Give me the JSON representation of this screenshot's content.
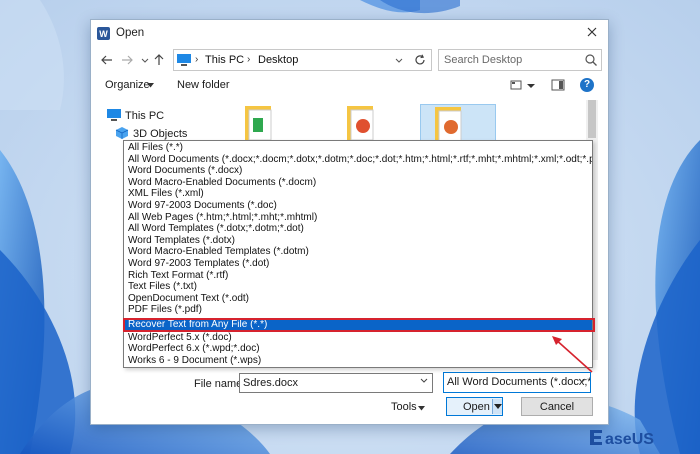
{
  "window": {
    "title": "Open",
    "app_icon": "word-icon"
  },
  "nav": {
    "back_icon": "back-arrow-icon",
    "forward_icon": "forward-arrow-icon",
    "recent_icon": "chevron-down-icon",
    "up_icon": "up-arrow-icon",
    "breadcrumb": [
      "This PC",
      "Desktop"
    ],
    "refresh_icon": "refresh-icon",
    "search_placeholder": "Search Desktop"
  },
  "toolbar": {
    "organize_label": "Organize",
    "new_folder_label": "New folder",
    "help_label": "?"
  },
  "navpane": {
    "items": [
      {
        "label": "This PC",
        "icon": "computer-icon"
      },
      {
        "label": "3D Objects",
        "icon": "cube-icon"
      }
    ]
  },
  "file_types": {
    "options": [
      "All Files (*.*)",
      "All Word Documents (*.docx;*.docm;*.dotx;*.dotm;*.doc;*.dot;*.htm;*.html;*.rtf;*.mht;*.mhtml;*.xml;*.odt;*.pdf)",
      "Word Documents (*.docx)",
      "Word Macro-Enabled Documents (*.docm)",
      "XML Files (*.xml)",
      "Word 97-2003 Documents (*.doc)",
      "All Web Pages (*.htm;*.html;*.mht;*.mhtml)",
      "All Word Templates (*.dotx;*.dotm;*.dot)",
      "Word Templates (*.dotx)",
      "Word Macro-Enabled Templates (*.dotm)",
      "Word 97-2003 Templates (*.dot)",
      "Rich Text Format (*.rtf)",
      "Text Files (*.txt)",
      "OpenDocument Text (*.odt)",
      "PDF Files (*.pdf)",
      "Recover Text from Any File (*.*)",
      "WordPerfect 5.x (*.doc)",
      "WordPerfect 6.x (*.wpd;*.doc)",
      "Works 6 - 9 Document (*.wps)"
    ],
    "highlighted": "Recover Text from Any File (*.*)"
  },
  "footer": {
    "file_name_label": "File name:",
    "file_name_value": "Sdres.docx",
    "file_type_value": "All Word Documents (*.docx;*.d",
    "tools_label": "Tools",
    "open_label": "Open",
    "cancel_label": "Cancel"
  },
  "annotation": {
    "highlight_color": "#d6232e",
    "selection_color": "#0a64c8"
  },
  "watermark": {
    "brand": "EaseUS"
  }
}
